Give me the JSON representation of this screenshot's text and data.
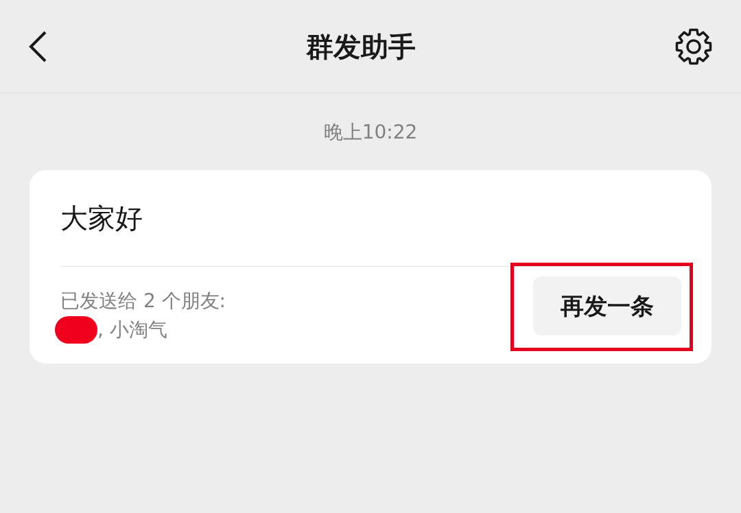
{
  "header": {
    "title": "群发助手"
  },
  "timestamp": "晚上10:22",
  "message": {
    "text": "大家好",
    "sent_to": "已发送给 2 个朋友:",
    "recipients": ", 小淘气",
    "button": "再发一条"
  }
}
